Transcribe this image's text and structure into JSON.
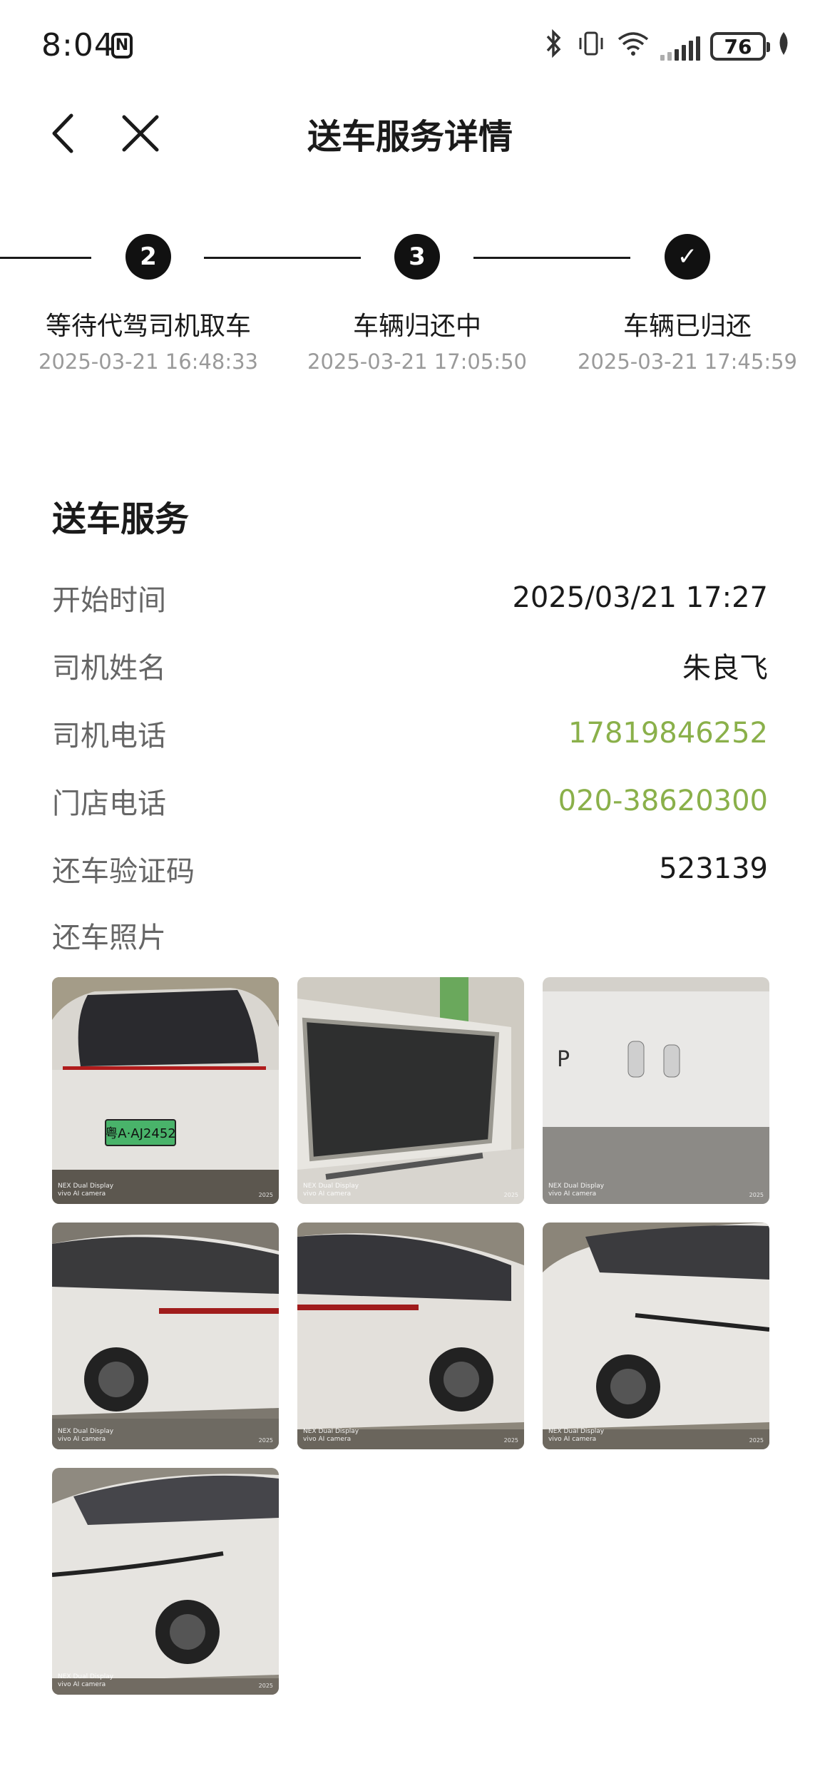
{
  "status_bar": {
    "time": "8:04",
    "battery": "76"
  },
  "header": {
    "title": "送车服务详情"
  },
  "steps": [
    {
      "badge": "2",
      "label": "等待代驾司机取车",
      "time": "2025-03-21 16:48:33"
    },
    {
      "badge": "3",
      "label": "车辆归还中",
      "time": "2025-03-21 17:05:50"
    },
    {
      "badge": "✓",
      "label": "车辆已归还",
      "time": "2025-03-21 17:45:59"
    }
  ],
  "service": {
    "title": "送车服务",
    "rows": [
      {
        "label": "开始时间",
        "value": "2025/03/21 17:27"
      },
      {
        "label": "司机姓名",
        "value": "朱良飞"
      },
      {
        "label": "司机电话",
        "value": "17819846252"
      },
      {
        "label": "门店电话",
        "value": "020-38620300"
      },
      {
        "label": "还车验证码",
        "value": "523139"
      }
    ],
    "photos_label": "还车照片",
    "photo_watermark_line1": "NEX Dual Display",
    "photo_watermark_line2": "vivo AI camera",
    "photo_year": "2025",
    "plate_text": "粤A·AJ2452"
  },
  "colors": {
    "link": "#8ab04a",
    "stepper": "#111111"
  }
}
